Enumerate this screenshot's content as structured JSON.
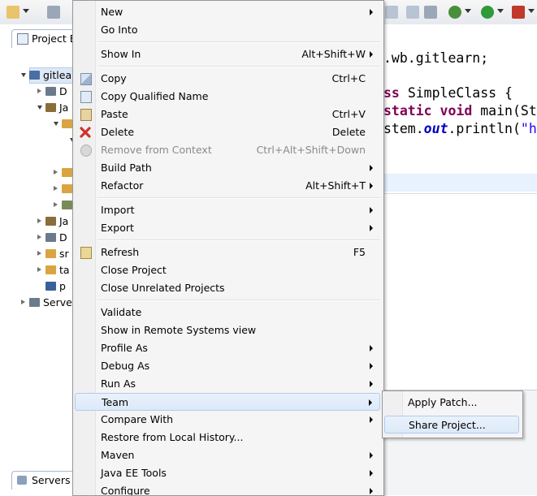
{
  "toolbar": {
    "icons": [
      "new-icon",
      "save-icon",
      "toolbar-icon-3",
      "toolbar-icon-4",
      "toolbar-icon-5",
      "debug-icon",
      "run-icon",
      "external-tools-icon"
    ]
  },
  "project_explorer": {
    "tab_label": "Project E",
    "items": [
      {
        "label": "gitlea",
        "indent": 0,
        "expanded": true,
        "icon": "java-project-icon",
        "color": "#4a6fa5"
      },
      {
        "label": "D",
        "indent": 1,
        "expanded": false,
        "icon": "deployment-descriptor-icon",
        "color": "#6b7b8c"
      },
      {
        "label": "Ja",
        "indent": 1,
        "expanded": true,
        "icon": "java-resources-icon",
        "color": "#8a6d3b"
      },
      {
        "label": "",
        "indent": 2,
        "expanded": true,
        "icon": "source-folder-icon",
        "color": "#d9a441"
      },
      {
        "label": "",
        "indent": 3,
        "expanded": true,
        "icon": "package-icon",
        "color": "#c58b2a"
      },
      {
        "label": "",
        "indent": 2,
        "expanded": false,
        "icon": "source-folder-icon",
        "color": "#d9a441"
      },
      {
        "label": "",
        "indent": 2,
        "expanded": false,
        "icon": "source-folder-icon",
        "color": "#d9a441"
      },
      {
        "label": "",
        "indent": 2,
        "expanded": false,
        "icon": "libraries-icon",
        "color": "#7a8b5a"
      },
      {
        "label": "Ja",
        "indent": 1,
        "expanded": false,
        "icon": "jar-icon",
        "color": "#8a6d3b"
      },
      {
        "label": "D",
        "indent": 1,
        "expanded": false,
        "icon": "deployed-resources-icon",
        "color": "#6b7b8c"
      },
      {
        "label": "sr",
        "indent": 1,
        "expanded": false,
        "icon": "folder-icon",
        "color": "#d9a441"
      },
      {
        "label": "ta",
        "indent": 1,
        "expanded": false,
        "icon": "folder-icon",
        "color": "#d9a441"
      },
      {
        "label": "p",
        "indent": 1,
        "expanded": null,
        "icon": "maven-pom-icon",
        "color": "#3a5f9a"
      },
      {
        "label": "Serve",
        "indent": 0,
        "expanded": false,
        "icon": "servers-folder-icon",
        "color": "#6b7b8c"
      }
    ],
    "servers_tab": "Servers"
  },
  "editor": {
    "lines": [
      {
        "parts": [
          {
            "t": ".wb.gitlearn;",
            "c": ""
          }
        ]
      },
      {
        "parts": [
          {
            "t": "ss ",
            "c": "kw"
          },
          {
            "t": "SimpleClass {",
            "c": ""
          }
        ]
      },
      {
        "parts": [
          {
            "t": "static void ",
            "c": "kw"
          },
          {
            "t": "main(St",
            "c": ""
          }
        ]
      },
      {
        "parts": [
          {
            "t": "stem.",
            "c": ""
          },
          {
            "t": "out",
            "c": "fld"
          },
          {
            "t": ".println(",
            "c": ""
          },
          {
            "t": "\"he",
            "c": "str"
          }
        ]
      }
    ]
  },
  "context_menu": {
    "groups": [
      [
        {
          "label": "New",
          "accel": "",
          "submenu": true,
          "disabled": false,
          "icon": ""
        },
        {
          "label": "Go Into",
          "accel": "",
          "submenu": false,
          "disabled": false,
          "icon": ""
        }
      ],
      [
        {
          "label": "Show In",
          "accel": "Alt+Shift+W",
          "submenu": true,
          "disabled": false,
          "icon": ""
        }
      ],
      [
        {
          "label": "Copy",
          "accel": "Ctrl+C",
          "submenu": false,
          "disabled": false,
          "icon": "copy-icon"
        },
        {
          "label": "Copy Qualified Name",
          "accel": "",
          "submenu": false,
          "disabled": false,
          "icon": "copy-qualified-name-icon"
        },
        {
          "label": "Paste",
          "accel": "Ctrl+V",
          "submenu": false,
          "disabled": false,
          "icon": "paste-icon"
        },
        {
          "label": "Delete",
          "accel": "Delete",
          "submenu": false,
          "disabled": false,
          "icon": "delete-icon"
        },
        {
          "label": "Remove from Context",
          "accel": "Ctrl+Alt+Shift+Down",
          "submenu": false,
          "disabled": true,
          "icon": "remove-context-icon"
        },
        {
          "label": "Build Path",
          "accel": "",
          "submenu": true,
          "disabled": false,
          "icon": ""
        },
        {
          "label": "Refactor",
          "accel": "Alt+Shift+T",
          "submenu": true,
          "disabled": false,
          "icon": ""
        }
      ],
      [
        {
          "label": "Import",
          "accel": "",
          "submenu": true,
          "disabled": false,
          "icon": ""
        },
        {
          "label": "Export",
          "accel": "",
          "submenu": true,
          "disabled": false,
          "icon": ""
        }
      ],
      [
        {
          "label": "Refresh",
          "accel": "F5",
          "submenu": false,
          "disabled": false,
          "icon": "refresh-icon"
        },
        {
          "label": "Close Project",
          "accel": "",
          "submenu": false,
          "disabled": false,
          "icon": ""
        },
        {
          "label": "Close Unrelated Projects",
          "accel": "",
          "submenu": false,
          "disabled": false,
          "icon": ""
        }
      ],
      [
        {
          "label": "Validate",
          "accel": "",
          "submenu": false,
          "disabled": false,
          "icon": ""
        },
        {
          "label": "Show in Remote Systems view",
          "accel": "",
          "submenu": false,
          "disabled": false,
          "icon": ""
        },
        {
          "label": "Profile As",
          "accel": "",
          "submenu": true,
          "disabled": false,
          "icon": ""
        },
        {
          "label": "Debug As",
          "accel": "",
          "submenu": true,
          "disabled": false,
          "icon": ""
        },
        {
          "label": "Run As",
          "accel": "",
          "submenu": true,
          "disabled": false,
          "icon": ""
        },
        {
          "label": "Team",
          "accel": "",
          "submenu": true,
          "disabled": false,
          "icon": "",
          "highlighted": true
        },
        {
          "label": "Compare With",
          "accel": "",
          "submenu": true,
          "disabled": false,
          "icon": ""
        },
        {
          "label": "Restore from Local History...",
          "accel": "",
          "submenu": false,
          "disabled": false,
          "icon": ""
        },
        {
          "label": "Maven",
          "accel": "",
          "submenu": true,
          "disabled": false,
          "icon": ""
        },
        {
          "label": "Java EE Tools",
          "accel": "",
          "submenu": true,
          "disabled": false,
          "icon": ""
        },
        {
          "label": "Configure",
          "accel": "",
          "submenu": true,
          "disabled": false,
          "icon": ""
        }
      ]
    ]
  },
  "team_submenu": {
    "items": [
      {
        "label": "Apply Patch...",
        "highlighted": false
      },
      {
        "label": "Share Project...",
        "highlighted": true
      }
    ]
  }
}
